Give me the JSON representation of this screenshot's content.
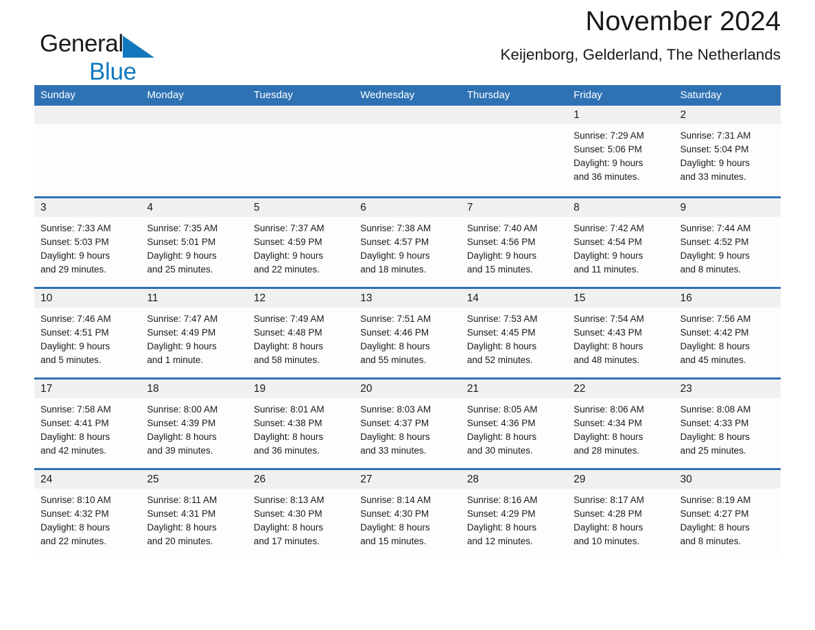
{
  "brand": {
    "name_part1": "General",
    "name_part2": "Blue",
    "triangle_icon": "blue-triangle-icon",
    "accent_color": "#1278be"
  },
  "header": {
    "title": "November 2024",
    "subtitle": "Keijenborg, Gelderland, The Netherlands"
  },
  "theme": {
    "header_row_bg": "#2e72b3",
    "daynum_band_bg": "#f0f0f0",
    "cell_bg": "#fdfdfd",
    "text_color": "#1a1a1a"
  },
  "weekdays": [
    "Sunday",
    "Monday",
    "Tuesday",
    "Wednesday",
    "Thursday",
    "Friday",
    "Saturday"
  ],
  "weeks": [
    [
      {
        "day": "",
        "sunrise": "",
        "sunset": "",
        "daylight1": "",
        "daylight2": ""
      },
      {
        "day": "",
        "sunrise": "",
        "sunset": "",
        "daylight1": "",
        "daylight2": ""
      },
      {
        "day": "",
        "sunrise": "",
        "sunset": "",
        "daylight1": "",
        "daylight2": ""
      },
      {
        "day": "",
        "sunrise": "",
        "sunset": "",
        "daylight1": "",
        "daylight2": ""
      },
      {
        "day": "",
        "sunrise": "",
        "sunset": "",
        "daylight1": "",
        "daylight2": ""
      },
      {
        "day": "1",
        "sunrise": "Sunrise: 7:29 AM",
        "sunset": "Sunset: 5:06 PM",
        "daylight1": "Daylight: 9 hours",
        "daylight2": "and 36 minutes."
      },
      {
        "day": "2",
        "sunrise": "Sunrise: 7:31 AM",
        "sunset": "Sunset: 5:04 PM",
        "daylight1": "Daylight: 9 hours",
        "daylight2": "and 33 minutes."
      }
    ],
    [
      {
        "day": "3",
        "sunrise": "Sunrise: 7:33 AM",
        "sunset": "Sunset: 5:03 PM",
        "daylight1": "Daylight: 9 hours",
        "daylight2": "and 29 minutes."
      },
      {
        "day": "4",
        "sunrise": "Sunrise: 7:35 AM",
        "sunset": "Sunset: 5:01 PM",
        "daylight1": "Daylight: 9 hours",
        "daylight2": "and 25 minutes."
      },
      {
        "day": "5",
        "sunrise": "Sunrise: 7:37 AM",
        "sunset": "Sunset: 4:59 PM",
        "daylight1": "Daylight: 9 hours",
        "daylight2": "and 22 minutes."
      },
      {
        "day": "6",
        "sunrise": "Sunrise: 7:38 AM",
        "sunset": "Sunset: 4:57 PM",
        "daylight1": "Daylight: 9 hours",
        "daylight2": "and 18 minutes."
      },
      {
        "day": "7",
        "sunrise": "Sunrise: 7:40 AM",
        "sunset": "Sunset: 4:56 PM",
        "daylight1": "Daylight: 9 hours",
        "daylight2": "and 15 minutes."
      },
      {
        "day": "8",
        "sunrise": "Sunrise: 7:42 AM",
        "sunset": "Sunset: 4:54 PM",
        "daylight1": "Daylight: 9 hours",
        "daylight2": "and 11 minutes."
      },
      {
        "day": "9",
        "sunrise": "Sunrise: 7:44 AM",
        "sunset": "Sunset: 4:52 PM",
        "daylight1": "Daylight: 9 hours",
        "daylight2": "and 8 minutes."
      }
    ],
    [
      {
        "day": "10",
        "sunrise": "Sunrise: 7:46 AM",
        "sunset": "Sunset: 4:51 PM",
        "daylight1": "Daylight: 9 hours",
        "daylight2": "and 5 minutes."
      },
      {
        "day": "11",
        "sunrise": "Sunrise: 7:47 AM",
        "sunset": "Sunset: 4:49 PM",
        "daylight1": "Daylight: 9 hours",
        "daylight2": "and 1 minute."
      },
      {
        "day": "12",
        "sunrise": "Sunrise: 7:49 AM",
        "sunset": "Sunset: 4:48 PM",
        "daylight1": "Daylight: 8 hours",
        "daylight2": "and 58 minutes."
      },
      {
        "day": "13",
        "sunrise": "Sunrise: 7:51 AM",
        "sunset": "Sunset: 4:46 PM",
        "daylight1": "Daylight: 8 hours",
        "daylight2": "and 55 minutes."
      },
      {
        "day": "14",
        "sunrise": "Sunrise: 7:53 AM",
        "sunset": "Sunset: 4:45 PM",
        "daylight1": "Daylight: 8 hours",
        "daylight2": "and 52 minutes."
      },
      {
        "day": "15",
        "sunrise": "Sunrise: 7:54 AM",
        "sunset": "Sunset: 4:43 PM",
        "daylight1": "Daylight: 8 hours",
        "daylight2": "and 48 minutes."
      },
      {
        "day": "16",
        "sunrise": "Sunrise: 7:56 AM",
        "sunset": "Sunset: 4:42 PM",
        "daylight1": "Daylight: 8 hours",
        "daylight2": "and 45 minutes."
      }
    ],
    [
      {
        "day": "17",
        "sunrise": "Sunrise: 7:58 AM",
        "sunset": "Sunset: 4:41 PM",
        "daylight1": "Daylight: 8 hours",
        "daylight2": "and 42 minutes."
      },
      {
        "day": "18",
        "sunrise": "Sunrise: 8:00 AM",
        "sunset": "Sunset: 4:39 PM",
        "daylight1": "Daylight: 8 hours",
        "daylight2": "and 39 minutes."
      },
      {
        "day": "19",
        "sunrise": "Sunrise: 8:01 AM",
        "sunset": "Sunset: 4:38 PM",
        "daylight1": "Daylight: 8 hours",
        "daylight2": "and 36 minutes."
      },
      {
        "day": "20",
        "sunrise": "Sunrise: 8:03 AM",
        "sunset": "Sunset: 4:37 PM",
        "daylight1": "Daylight: 8 hours",
        "daylight2": "and 33 minutes."
      },
      {
        "day": "21",
        "sunrise": "Sunrise: 8:05 AM",
        "sunset": "Sunset: 4:36 PM",
        "daylight1": "Daylight: 8 hours",
        "daylight2": "and 30 minutes."
      },
      {
        "day": "22",
        "sunrise": "Sunrise: 8:06 AM",
        "sunset": "Sunset: 4:34 PM",
        "daylight1": "Daylight: 8 hours",
        "daylight2": "and 28 minutes."
      },
      {
        "day": "23",
        "sunrise": "Sunrise: 8:08 AM",
        "sunset": "Sunset: 4:33 PM",
        "daylight1": "Daylight: 8 hours",
        "daylight2": "and 25 minutes."
      }
    ],
    [
      {
        "day": "24",
        "sunrise": "Sunrise: 8:10 AM",
        "sunset": "Sunset: 4:32 PM",
        "daylight1": "Daylight: 8 hours",
        "daylight2": "and 22 minutes."
      },
      {
        "day": "25",
        "sunrise": "Sunrise: 8:11 AM",
        "sunset": "Sunset: 4:31 PM",
        "daylight1": "Daylight: 8 hours",
        "daylight2": "and 20 minutes."
      },
      {
        "day": "26",
        "sunrise": "Sunrise: 8:13 AM",
        "sunset": "Sunset: 4:30 PM",
        "daylight1": "Daylight: 8 hours",
        "daylight2": "and 17 minutes."
      },
      {
        "day": "27",
        "sunrise": "Sunrise: 8:14 AM",
        "sunset": "Sunset: 4:30 PM",
        "daylight1": "Daylight: 8 hours",
        "daylight2": "and 15 minutes."
      },
      {
        "day": "28",
        "sunrise": "Sunrise: 8:16 AM",
        "sunset": "Sunset: 4:29 PM",
        "daylight1": "Daylight: 8 hours",
        "daylight2": "and 12 minutes."
      },
      {
        "day": "29",
        "sunrise": "Sunrise: 8:17 AM",
        "sunset": "Sunset: 4:28 PM",
        "daylight1": "Daylight: 8 hours",
        "daylight2": "and 10 minutes."
      },
      {
        "day": "30",
        "sunrise": "Sunrise: 8:19 AM",
        "sunset": "Sunset: 4:27 PM",
        "daylight1": "Daylight: 8 hours",
        "daylight2": "and 8 minutes."
      }
    ]
  ]
}
